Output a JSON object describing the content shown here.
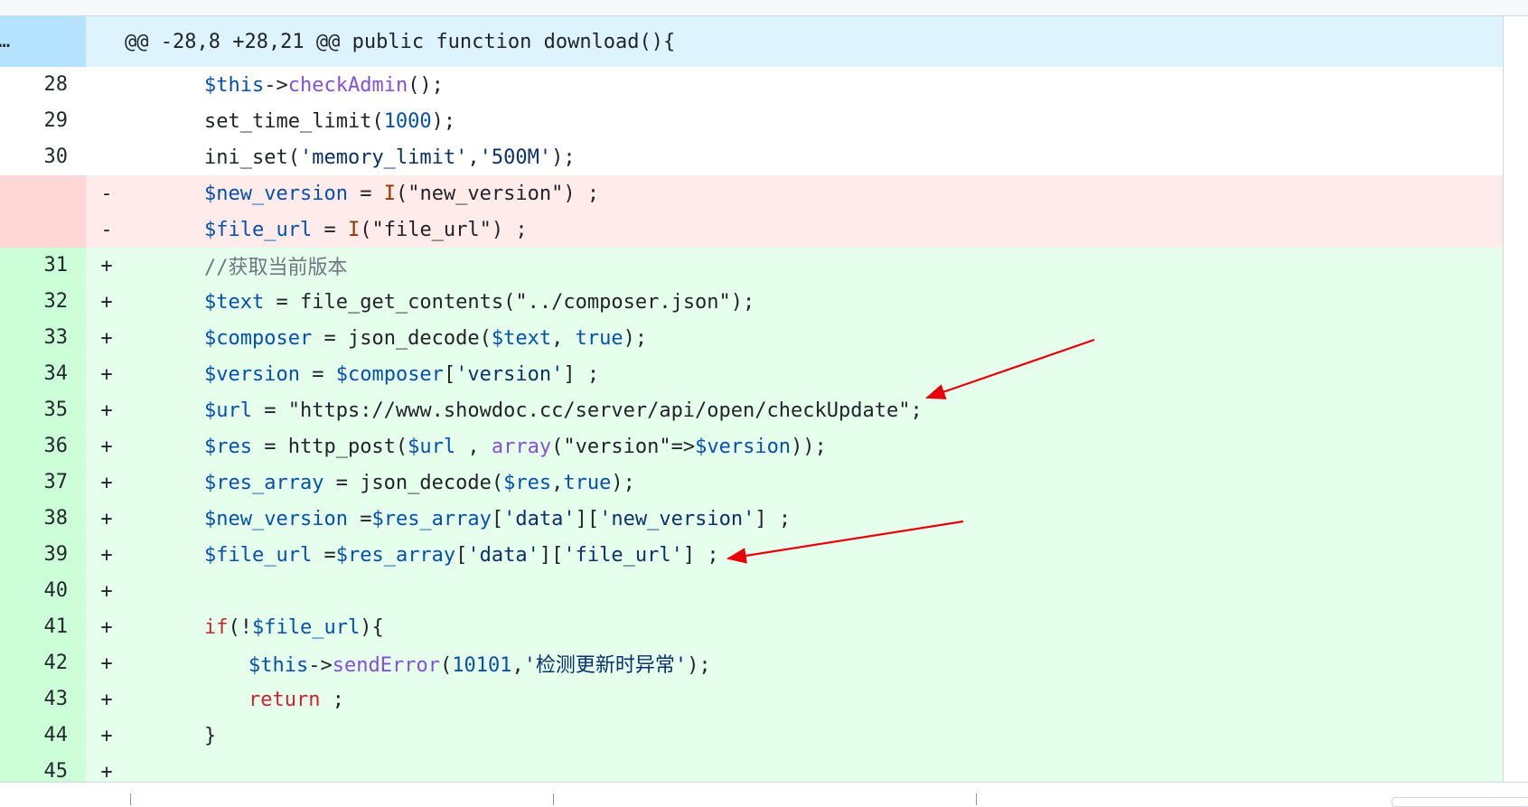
{
  "hunk_header": "@@ -28,8 +28,21 @@ public function download(){",
  "expand_glyph": "…",
  "lines": [
    {
      "type": "context",
      "num": "28",
      "mark": "",
      "indent": 1,
      "tokens": [
        [
          "var",
          "$this"
        ],
        [
          "plain",
          "->"
        ],
        [
          "fn",
          "checkAdmin"
        ],
        [
          "plain",
          "();"
        ]
      ]
    },
    {
      "type": "context",
      "num": "29",
      "mark": "",
      "indent": 1,
      "tokens": [
        [
          "plain",
          "set_time_limit("
        ],
        [
          "num",
          "1000"
        ],
        [
          "plain",
          ");"
        ]
      ]
    },
    {
      "type": "context",
      "num": "30",
      "mark": "",
      "indent": 1,
      "tokens": [
        [
          "plain",
          "ini_set("
        ],
        [
          "str",
          "'memory_limit'"
        ],
        [
          "plain",
          ","
        ],
        [
          "str",
          "'500M'"
        ],
        [
          "plain",
          ");"
        ]
      ]
    },
    {
      "type": "del",
      "num": "",
      "mark": "-",
      "indent": 1,
      "tokens": [
        [
          "var",
          "$new_version"
        ],
        [
          "plain",
          " = "
        ],
        [
          "i",
          "I"
        ],
        [
          "plain",
          "(\"new_version\") ;"
        ]
      ]
    },
    {
      "type": "del",
      "num": "",
      "mark": "-",
      "indent": 1,
      "tokens": [
        [
          "var",
          "$file_url"
        ],
        [
          "plain",
          " = "
        ],
        [
          "i",
          "I"
        ],
        [
          "plain",
          "(\"file_url\") ;"
        ]
      ]
    },
    {
      "type": "add",
      "num": "31",
      "mark": "+",
      "indent": 1,
      "tokens": [
        [
          "com",
          "//获取当前版本"
        ]
      ]
    },
    {
      "type": "add",
      "num": "32",
      "mark": "+",
      "indent": 1,
      "tokens": [
        [
          "var",
          "$text"
        ],
        [
          "plain",
          " = file_get_contents(\"../composer.json\");"
        ]
      ]
    },
    {
      "type": "add",
      "num": "33",
      "mark": "+",
      "indent": 1,
      "tokens": [
        [
          "var",
          "$composer"
        ],
        [
          "plain",
          " = json_decode("
        ],
        [
          "var",
          "$text"
        ],
        [
          "plain",
          ", "
        ],
        [
          "num",
          "true"
        ],
        [
          "plain",
          ");"
        ]
      ]
    },
    {
      "type": "add",
      "num": "34",
      "mark": "+",
      "indent": 1,
      "tokens": [
        [
          "var",
          "$version"
        ],
        [
          "plain",
          " = "
        ],
        [
          "var",
          "$composer"
        ],
        [
          "plain",
          "["
        ],
        [
          "str",
          "'version'"
        ],
        [
          "plain",
          "] ;"
        ]
      ]
    },
    {
      "type": "add",
      "num": "35",
      "mark": "+",
      "indent": 1,
      "tokens": [
        [
          "var",
          "$url"
        ],
        [
          "plain",
          " = \"https://www.showdoc.cc/server/api/open/checkUpdate\";"
        ]
      ]
    },
    {
      "type": "add",
      "num": "36",
      "mark": "+",
      "indent": 1,
      "tokens": [
        [
          "var",
          "$res"
        ],
        [
          "plain",
          " = http_post("
        ],
        [
          "var",
          "$url"
        ],
        [
          "plain",
          " , "
        ],
        [
          "fn",
          "array"
        ],
        [
          "plain",
          "(\"version\"=>"
        ],
        [
          "var",
          "$version"
        ],
        [
          "plain",
          "));"
        ]
      ]
    },
    {
      "type": "add",
      "num": "37",
      "mark": "+",
      "indent": 1,
      "tokens": [
        [
          "var",
          "$res_array"
        ],
        [
          "plain",
          " = json_decode("
        ],
        [
          "var",
          "$res"
        ],
        [
          "plain",
          ","
        ],
        [
          "num",
          "true"
        ],
        [
          "plain",
          ");"
        ]
      ]
    },
    {
      "type": "add",
      "num": "38",
      "mark": "+",
      "indent": 1,
      "tokens": [
        [
          "var",
          "$new_version"
        ],
        [
          "plain",
          " ="
        ],
        [
          "var",
          "$res_array"
        ],
        [
          "plain",
          "["
        ],
        [
          "str",
          "'data'"
        ],
        [
          "plain",
          "]["
        ],
        [
          "str",
          "'new_version'"
        ],
        [
          "plain",
          "] ;"
        ]
      ]
    },
    {
      "type": "add",
      "num": "39",
      "mark": "+",
      "indent": 1,
      "tokens": [
        [
          "var",
          "$file_url"
        ],
        [
          "plain",
          " ="
        ],
        [
          "var",
          "$res_array"
        ],
        [
          "plain",
          "["
        ],
        [
          "str",
          "'data'"
        ],
        [
          "plain",
          "]["
        ],
        [
          "str",
          "'file_url'"
        ],
        [
          "plain",
          "] ;"
        ]
      ]
    },
    {
      "type": "add",
      "num": "40",
      "mark": "+",
      "indent": 1,
      "tokens": []
    },
    {
      "type": "add",
      "num": "41",
      "mark": "+",
      "indent": 1,
      "tokens": [
        [
          "kw",
          "if"
        ],
        [
          "plain",
          "(!"
        ],
        [
          "var",
          "$file_url"
        ],
        [
          "plain",
          "){"
        ]
      ]
    },
    {
      "type": "add",
      "num": "42",
      "mark": "+",
      "indent": 2,
      "tokens": [
        [
          "var",
          "$this"
        ],
        [
          "plain",
          "->"
        ],
        [
          "fn",
          "sendError"
        ],
        [
          "plain",
          "("
        ],
        [
          "num",
          "10101"
        ],
        [
          "plain",
          ","
        ],
        [
          "str",
          "'检测更新时异常'"
        ],
        [
          "plain",
          ");"
        ]
      ]
    },
    {
      "type": "add",
      "num": "43",
      "mark": "+",
      "indent": 2,
      "tokens": [
        [
          "kw",
          "return"
        ],
        [
          "plain",
          " ;"
        ]
      ]
    },
    {
      "type": "add",
      "num": "44",
      "mark": "+",
      "indent": 1,
      "tokens": [
        [
          "plain",
          "}"
        ]
      ]
    },
    {
      "type": "add",
      "num": "45",
      "mark": "+",
      "indent": 1,
      "tokens": []
    }
  ],
  "annotation_color": "#e8000b"
}
